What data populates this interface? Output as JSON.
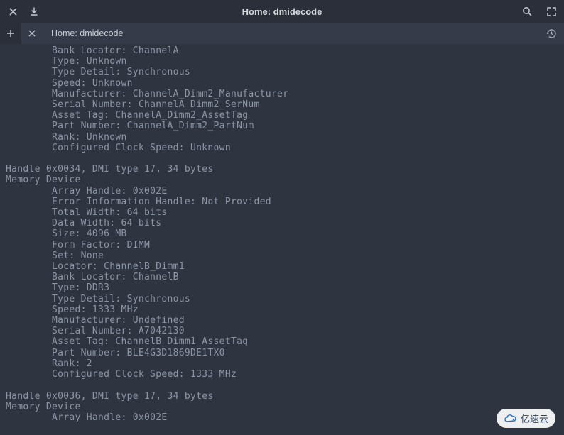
{
  "window": {
    "title": "Home: dmidecode"
  },
  "tab": {
    "label": "Home: dmidecode"
  },
  "terminal_lines": [
    "        Bank Locator: ChannelA",
    "        Type: Unknown",
    "        Type Detail: Synchronous",
    "        Speed: Unknown",
    "        Manufacturer: ChannelA_Dimm2_Manufacturer",
    "        Serial Number: ChannelA_Dimm2_SerNum",
    "        Asset Tag: ChannelA_Dimm2_AssetTag",
    "        Part Number: ChannelA_Dimm2_PartNum",
    "        Rank: Unknown",
    "        Configured Clock Speed: Unknown",
    "",
    "Handle 0x0034, DMI type 17, 34 bytes",
    "Memory Device",
    "        Array Handle: 0x002E",
    "        Error Information Handle: Not Provided",
    "        Total Width: 64 bits",
    "        Data Width: 64 bits",
    "        Size: 4096 MB",
    "        Form Factor: DIMM",
    "        Set: None",
    "        Locator: ChannelB_Dimm1",
    "        Bank Locator: ChannelB",
    "        Type: DDR3",
    "        Type Detail: Synchronous",
    "        Speed: 1333 MHz",
    "        Manufacturer: Undefined",
    "        Serial Number: A7042130",
    "        Asset Tag: ChannelB_Dimm1_AssetTag",
    "        Part Number: BLE4G3D1869DE1TX0",
    "        Rank: 2",
    "        Configured Clock Speed: 1333 MHz",
    "",
    "Handle 0x0036, DMI type 17, 34 bytes",
    "Memory Device",
    "        Array Handle: 0x002E"
  ],
  "watermark": "亿速云"
}
